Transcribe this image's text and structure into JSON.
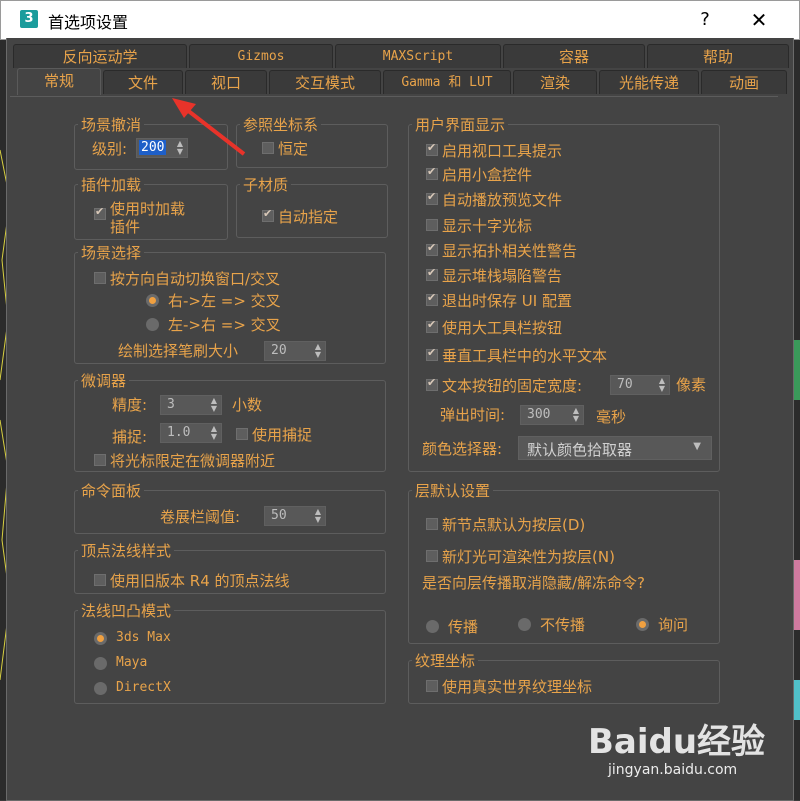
{
  "window": {
    "icon_label": "3",
    "title": "首选项设置",
    "help": "?",
    "close": "✕"
  },
  "tabs_row1": [
    "反向运动学",
    "Gizmos",
    "MAXScript",
    "容器",
    "帮助"
  ],
  "tabs_row2": [
    "常规",
    "文件",
    "视口",
    "交互模式",
    "Gamma 和 LUT",
    "渲染",
    "光能传递",
    "动画"
  ],
  "scene_undo": {
    "title": "场景撤消",
    "level_label": "级别:",
    "level_value": "200"
  },
  "ref_coord": {
    "title": "参照坐标系",
    "constant_label": "恒定",
    "constant_checked": false
  },
  "plugin_load": {
    "title": "插件加载",
    "load_on_use_label_1": "使用时加载",
    "load_on_use_label_2": "插件",
    "load_on_use_checked": true
  },
  "sub_material": {
    "title": "子材质",
    "auto_assign_label": "自动指定",
    "auto_assign_checked": true
  },
  "scene_select": {
    "title": "场景选择",
    "auto_switch_label": "按方向自动切换窗口/交叉",
    "auto_switch_checked": false,
    "right_left_label": "右->左 => 交叉",
    "left_right_label": "左->右 => 交叉",
    "brush_size_label": "绘制选择笔刷大小",
    "brush_size_value": "20"
  },
  "spinners": {
    "title": "微调器",
    "precision_label": "精度:",
    "precision_value": "3",
    "precision_unit": "小数",
    "snap_label": "捕捉:",
    "snap_value": "1.0",
    "use_snap_label": "使用捕捉",
    "use_snap_checked": false,
    "cursor_limit_label": "将光标限定在微调器附近",
    "cursor_limit_checked": false
  },
  "command_panel": {
    "title": "命令面板",
    "rollout_label": "卷展栏阈值:",
    "rollout_value": "50"
  },
  "vertex_normal": {
    "title": "顶点法线样式",
    "legacy_label": "使用旧版本 R4 的顶点法线",
    "legacy_checked": false
  },
  "normal_bump": {
    "title": "法线凹凸模式",
    "options": [
      "3ds Max",
      "Maya",
      "DirectX"
    ],
    "selected": "3ds Max"
  },
  "ui_display": {
    "title": "用户界面显示",
    "items": [
      {
        "label": "启用视口工具提示",
        "checked": true
      },
      {
        "label": "启用小盒控件",
        "checked": true
      },
      {
        "label": "自动播放预览文件",
        "checked": true
      },
      {
        "label": "显示十字光标",
        "checked": false
      },
      {
        "label": "显示拓扑相关性警告",
        "checked": true
      },
      {
        "label": "显示堆栈塌陷警告",
        "checked": true
      },
      {
        "label": "退出时保存 UI 配置",
        "checked": true
      },
      {
        "label": "使用大工具栏按钮",
        "checked": true
      },
      {
        "label": "垂直工具栏中的水平文本",
        "checked": true
      },
      {
        "label": "文本按钮的固定宽度:",
        "checked": true
      }
    ],
    "fixed_width_value": "70",
    "fixed_width_unit": "像素",
    "flyout_label": "弹出时间:",
    "flyout_value": "300",
    "flyout_unit": "毫秒",
    "color_picker_label": "颜色选择器:",
    "color_picker_value": "默认颜色拾取器"
  },
  "layer_defaults": {
    "title": "层默认设置",
    "new_node_label": "新节点默认为按层(D)",
    "new_node_checked": false,
    "new_light_label": "新灯光可渲染性为按层(N)",
    "new_light_checked": false,
    "propagate_question": "是否向层传播取消隐藏/解冻命令?",
    "propagate_options": [
      "传播",
      "不传播",
      "询问"
    ],
    "propagate_selected": "询问"
  },
  "texture_coords": {
    "title": "纹理坐标",
    "real_world_label": "使用真实世界纹理坐标",
    "real_world_checked": false
  },
  "watermark": {
    "logo_text": "Baidu经验",
    "url": "jingyan.baidu.com"
  },
  "colors": {
    "accent": "#e8a34a",
    "panel": "#444444",
    "arrow": "#e8332a"
  }
}
